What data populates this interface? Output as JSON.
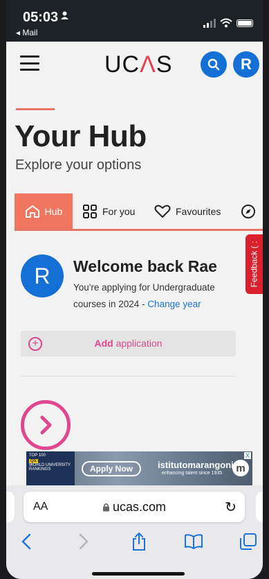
{
  "status_bar": {
    "time": "05:03",
    "back_app": "◂ Mail"
  },
  "header": {
    "logo_left": "UC",
    "logo_accent": "Λ",
    "logo_right": "S",
    "avatar_initial": "R"
  },
  "hub": {
    "title": "Your Hub",
    "subtitle": "Explore your options"
  },
  "tabs": [
    {
      "label": "Hub",
      "active": true
    },
    {
      "label": "For you"
    },
    {
      "label": "Favourites"
    }
  ],
  "feedback": {
    "label": "Feedback ( :"
  },
  "welcome": {
    "initial": "R",
    "title": "Welcome back Rae",
    "text": "You're applying for Undergraduate courses in 2024 - ",
    "link": "Change year"
  },
  "add_application": {
    "bold": "Add",
    "rest": " application"
  },
  "ad": {
    "rank_line1": "TOP 100",
    "rank_line2": "WORLD UNIVERSITY RANKINGS",
    "rank_year": "QS",
    "apply_label": "Apply Now",
    "brand": "istitutomarangoni",
    "tagline": "enhancing talent since 1935",
    "badge": "m",
    "close": "X"
  },
  "browser": {
    "text_size": "AA",
    "url": "ucas.com"
  },
  "colors": {
    "accent": "#e97568",
    "brand_blue": "#1570d6",
    "pink": "#d9488f",
    "feedback_red": "#d9202d"
  }
}
